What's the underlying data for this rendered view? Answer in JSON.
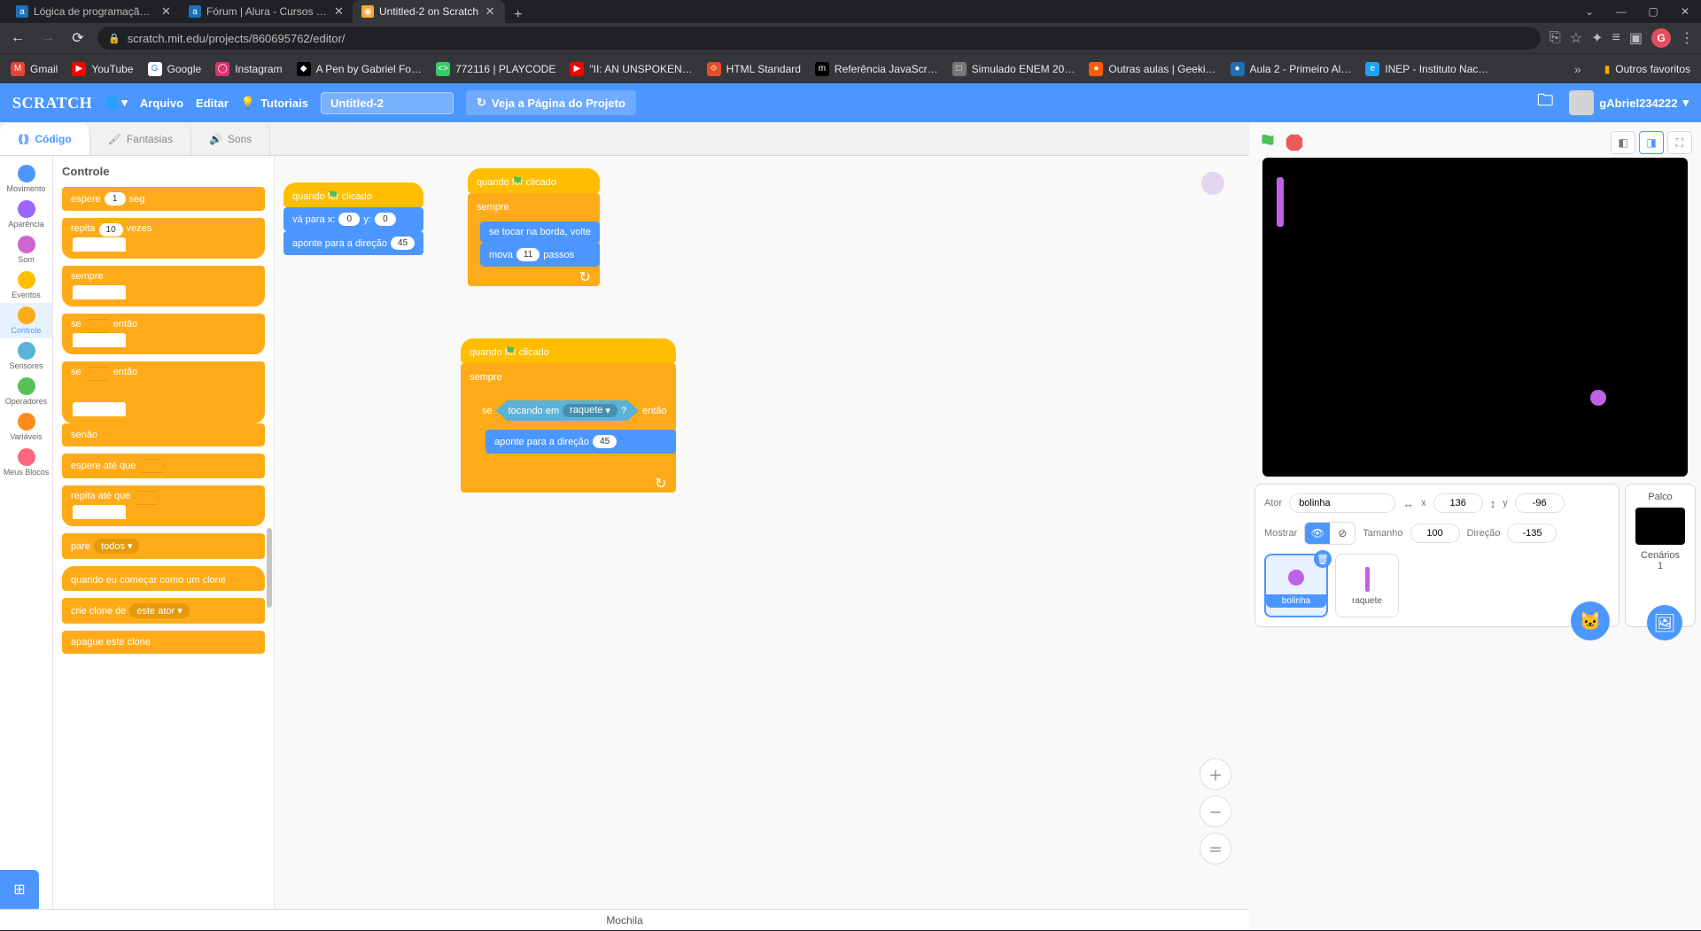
{
  "browser": {
    "tabs": [
      {
        "title": "Lógica de programação: comece",
        "favcolor": "#1d6fb8",
        "favtext": "a"
      },
      {
        "title": "Fórum | Alura - Cursos online de",
        "favcolor": "#1d6fb8",
        "favtext": "a"
      },
      {
        "title": "Untitled-2 on Scratch",
        "favcolor": "#f9a636",
        "favtext": "◉",
        "active": true
      }
    ],
    "url": "scratch.mit.edu/projects/860695762/editor/",
    "window_controls": {
      "min": "—",
      "max": "▢",
      "close": "✕",
      "dropdown": "⌄"
    },
    "profile_letter": "G",
    "bookmarks": [
      {
        "label": "Gmail",
        "color": "#ea4335",
        "sym": "M"
      },
      {
        "label": "YouTube",
        "color": "#ff0000",
        "sym": "▶"
      },
      {
        "label": "Google",
        "color": "#4285f4",
        "sym": "G"
      },
      {
        "label": "Instagram",
        "color": "#e1306c",
        "sym": "◯"
      },
      {
        "label": "A Pen by Gabriel Fo…",
        "color": "#000",
        "sym": "◆"
      },
      {
        "label": "772116 | PLAYCODE",
        "color": "#33cc66",
        "sym": "<>"
      },
      {
        "label": "\"II: AN UNSPOKEN…",
        "color": "#ff0000",
        "sym": "▶"
      },
      {
        "label": "HTML Standard",
        "color": "#e44d26",
        "sym": "⟐"
      },
      {
        "label": "Referência JavaScr…",
        "color": "#000",
        "sym": "m"
      },
      {
        "label": "Simulado ENEM 20…",
        "color": "#777",
        "sym": "□"
      },
      {
        "label": "Outras aulas | Geeki…",
        "color": "#ff5b00",
        "sym": "●"
      },
      {
        "label": "Aula 2 - Primeiro Al…",
        "color": "#1d6fb8",
        "sym": "●"
      },
      {
        "label": "INEP - Instituto Nac…",
        "color": "#1ea1f2",
        "sym": "e"
      }
    ],
    "bookmarks_more": "»",
    "other_bookmarks": "Outros favoritos"
  },
  "scratch_header": {
    "logo": "SCRATCH",
    "menu_file": "Arquivo",
    "menu_edit": "Editar",
    "tutorials": "Tutoriais",
    "project_title": "Untitled-2",
    "view_page": "Veja a Página do Projeto",
    "username": "gAbriel234222"
  },
  "editor_tabs": {
    "code": "Código",
    "costumes": "Fantasias",
    "sounds": "Sons"
  },
  "categories": [
    {
      "name": "Movimento",
      "color": "#4c97ff"
    },
    {
      "name": "Aparência",
      "color": "#9966ff"
    },
    {
      "name": "Som",
      "color": "#cf63cf"
    },
    {
      "name": "Eventos",
      "color": "#ffbf00"
    },
    {
      "name": "Controle",
      "color": "#ffab19",
      "active": true
    },
    {
      "name": "Sensores",
      "color": "#5cb1d6"
    },
    {
      "name": "Operadores",
      "color": "#59c059"
    },
    {
      "name": "Variáveis",
      "color": "#ff8c1a"
    },
    {
      "name": "Meus Blocos",
      "color": "#ff6680"
    }
  ],
  "palette": {
    "title": "Controle",
    "wait": {
      "prefix": "espere",
      "value": "1",
      "suffix": "seg"
    },
    "repeat": {
      "prefix": "repita",
      "value": "10",
      "suffix": "vezes"
    },
    "forever": "sempre",
    "if_then": {
      "if": "se",
      "then": "então"
    },
    "if_else": {
      "if": "se",
      "then": "então",
      "else": "senão"
    },
    "wait_until": "espere até que",
    "repeat_until": "repita até que",
    "stop": {
      "label": "pare",
      "menu": "todos"
    },
    "clone_start": "quando eu começar como um clone",
    "create_clone": {
      "label": "crie clone de",
      "menu": "este ator"
    },
    "delete_clone": "apague este clone"
  },
  "scripts": {
    "s1": {
      "hat": "quando       for clicado",
      "goto": {
        "prefix": "vá para x:",
        "x": "0",
        "mid": "y:",
        "y": "0"
      },
      "point": {
        "prefix": "aponte para a direção",
        "val": "45"
      }
    },
    "s2": {
      "hat": "quando       for clicado",
      "forever": "sempre",
      "bounce": "se tocar na borda, volte",
      "move": {
        "prefix": "mova",
        "val": "11",
        "suffix": "passos"
      }
    },
    "s3": {
      "hat": "quando       for clicado",
      "forever": "sempre",
      "if": "se",
      "then": "então",
      "touching": {
        "prefix": "tocando em",
        "menu": "raquete",
        "suffix": "?"
      },
      "point": {
        "prefix": "aponte para a direção",
        "val": "45"
      }
    }
  },
  "stage_info": {
    "actor_label": "Ator",
    "actor_name": "bolinha",
    "x_label": "x",
    "x_val": "136",
    "y_label": "y",
    "y_val": "-96",
    "show_label": "Mostrar",
    "size_label": "Tamanho",
    "size_val": "100",
    "dir_label": "Direção",
    "dir_val": "-135",
    "stage_label": "Palco",
    "backdrops_label": "Cenários",
    "backdrops_count": "1"
  },
  "sprites": [
    {
      "name": "bolinha",
      "selected": true
    },
    {
      "name": "raquete"
    }
  ],
  "backpack": "Mochila"
}
